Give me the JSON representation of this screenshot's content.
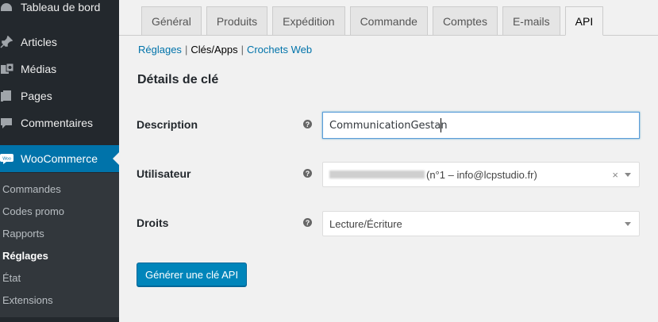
{
  "sidebar": {
    "items": [
      {
        "label": "Tableau de bord",
        "icon": "dashboard-icon"
      },
      {
        "label": "Articles",
        "icon": "pin-icon"
      },
      {
        "label": "Médias",
        "icon": "media-icon"
      },
      {
        "label": "Pages",
        "icon": "pages-icon"
      },
      {
        "label": "Commentaires",
        "icon": "comment-icon"
      },
      {
        "label": "WooCommerce",
        "icon": "woo-icon",
        "badge": "Woo"
      }
    ],
    "submenu": [
      "Commandes",
      "Codes promo",
      "Rapports",
      "Réglages",
      "État",
      "Extensions"
    ]
  },
  "tabs": [
    "Général",
    "Produits",
    "Expédition",
    "Commande",
    "Comptes",
    "E-mails",
    "API"
  ],
  "subnav": {
    "link1": "Réglages",
    "sep1": "|",
    "current": "Clés/Apps",
    "sep2": "|",
    "link2": "Crochets Web"
  },
  "section_title": "Détails de clé",
  "form": {
    "description": {
      "label": "Description",
      "value": "CommunicationGestan"
    },
    "user": {
      "label": "Utilisateur",
      "value": "(n°1 – info@lcpstudio.fr)",
      "clear": "×"
    },
    "rights": {
      "label": "Droits",
      "value": "Lecture/Écriture"
    },
    "help": "?"
  },
  "button": {
    "label": "Générer une clé API"
  },
  "colors": {
    "sidebar": "#23282d",
    "accent": "#0073aa",
    "primary_button": "#0085ba"
  }
}
